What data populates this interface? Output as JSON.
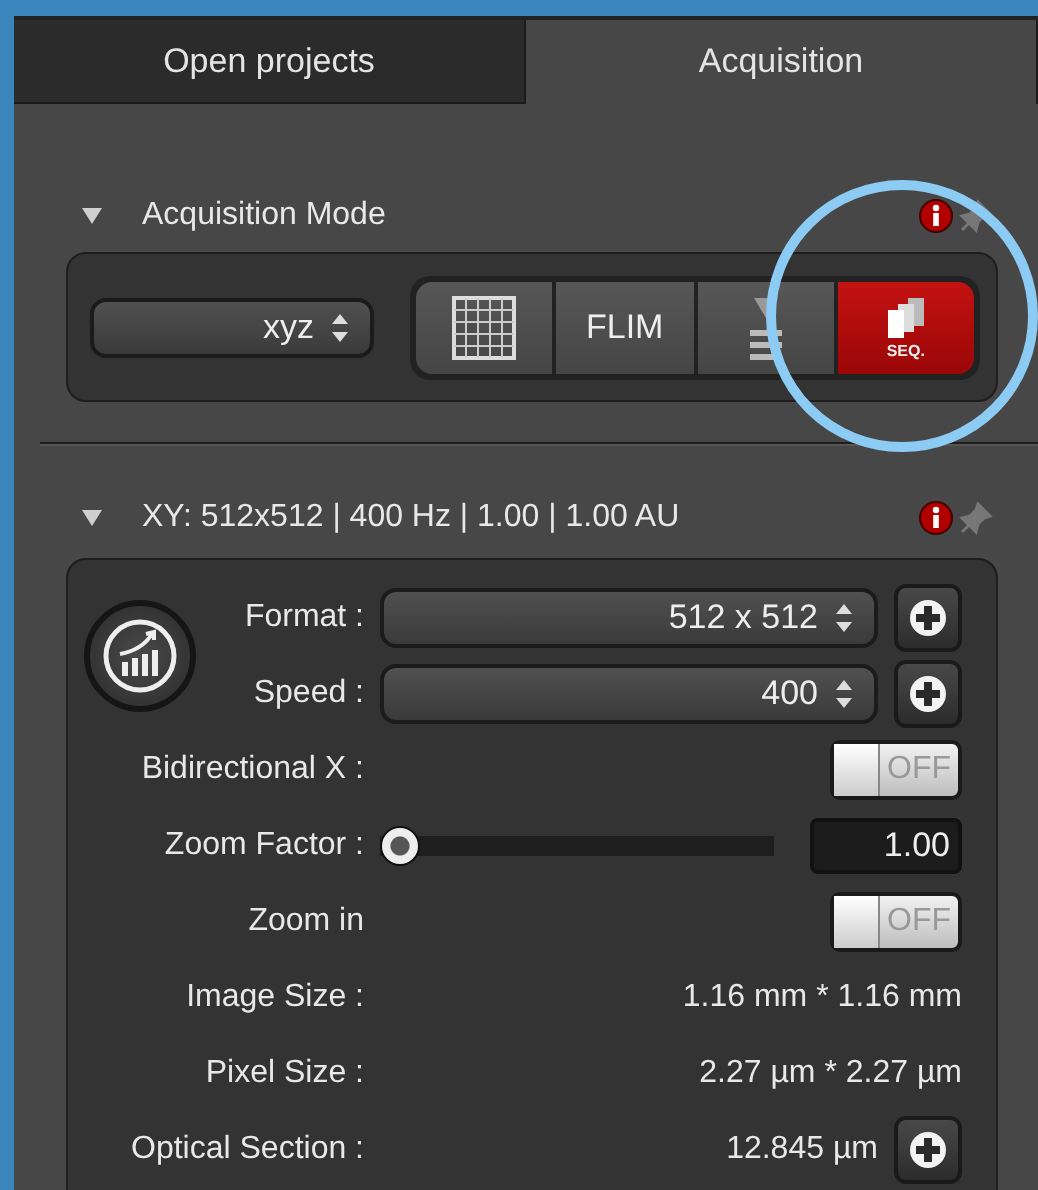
{
  "tabs": [
    {
      "label": "Open projects",
      "selected": false
    },
    {
      "label": "Acquisition",
      "selected": true
    }
  ],
  "acquisition_mode": {
    "title": "Acquisition Mode",
    "expanded": true,
    "mode": "xyz",
    "buttons": [
      {
        "kind": "grid",
        "selected": false
      },
      {
        "kind": "text",
        "label": "FLIM",
        "selected": false
      },
      {
        "kind": "stack",
        "selected": false
      },
      {
        "kind": "seq",
        "label": "SEQ.",
        "selected": true
      }
    ]
  },
  "xy_panel": {
    "title": "XY: 512x512 | 400 Hz | 1.00 | 1.00 AU",
    "expanded": true,
    "rows": [
      {
        "kind": "select",
        "label": "Format :",
        "value": "512 x 512",
        "add_button": true
      },
      {
        "kind": "select",
        "label": "Speed :",
        "value": "400",
        "add_button": true
      },
      {
        "kind": "toggle",
        "label": "Bidirectional X :",
        "on": false,
        "state_text": "OFF"
      },
      {
        "kind": "slider",
        "label": "Zoom Factor :",
        "level": 0,
        "value": "1.00"
      },
      {
        "kind": "toggle",
        "label": "Zoom in",
        "on": false,
        "state_text": "OFF"
      },
      {
        "kind": "readout",
        "label": "Image Size :",
        "value": "1.16 mm * 1.16 mm"
      },
      {
        "kind": "readout",
        "label": "Pixel Size :",
        "value": "2.27 µm * 2.27 µm"
      },
      {
        "kind": "readout",
        "label": "Optical Section :",
        "value": "12.845 µm",
        "add_button": true
      }
    ]
  }
}
